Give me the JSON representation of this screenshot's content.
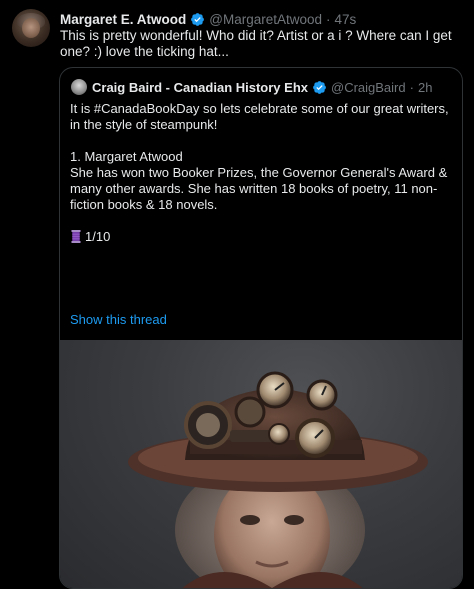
{
  "tweet": {
    "author_name": "Margaret E. Atwood",
    "handle": "@MargaretAtwood",
    "separator": "·",
    "time": "47s",
    "text": "This is pretty wonderful! Who did it? Artist or a i ? Where can I get one?  :) love the ticking hat...",
    "verified_color": "#1d9bf0"
  },
  "quoted": {
    "author_name": "Craig Baird - Canadian History Ehx",
    "handle": "@CraigBaird",
    "separator": "·",
    "time": "2h",
    "line1": "It is #CanadaBookDay so lets celebrate some of our great writers, in the style of steampunk!",
    "line2": "1. Margaret Atwood",
    "line3": "She has won two Booker Prizes, the Governor General's Award & many other awards. She has written 18 books of poetry, 11 non-fiction books & 18 novels.",
    "counter": "1/10",
    "show_thread": "Show this thread",
    "link_color": "#1d9bf0"
  },
  "icons": {
    "verified": "verified-badge-icon",
    "thread": "spool-of-thread-icon"
  }
}
